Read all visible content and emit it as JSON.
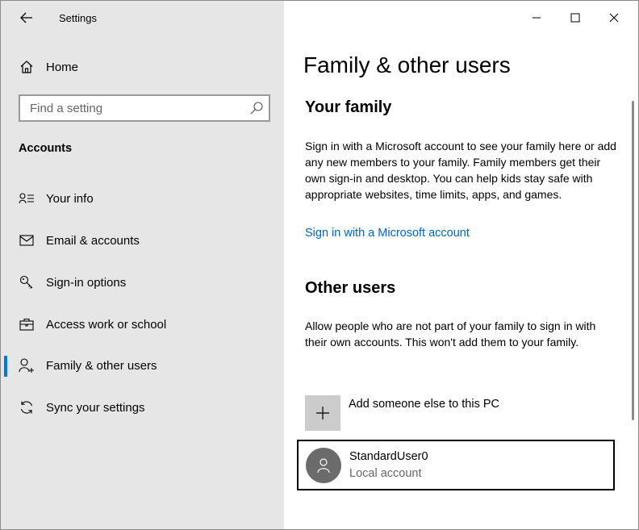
{
  "app": {
    "title": "Settings"
  },
  "sidebar": {
    "home_label": "Home",
    "search": {
      "placeholder": "Find a setting"
    },
    "section_title": "Accounts",
    "items": [
      {
        "label": "Your info",
        "icon": "person-list-icon"
      },
      {
        "label": "Email & accounts",
        "icon": "mail-icon"
      },
      {
        "label": "Sign-in options",
        "icon": "key-icon"
      },
      {
        "label": "Access work or school",
        "icon": "briefcase-icon"
      },
      {
        "label": "Family & other users",
        "icon": "person-add-icon",
        "active": true
      },
      {
        "label": "Sync your settings",
        "icon": "sync-icon"
      }
    ]
  },
  "window_controls": [
    "minimize",
    "maximize",
    "close"
  ],
  "content": {
    "title": "Family & other users",
    "family": {
      "heading": "Your family",
      "description": "Sign in with a Microsoft account to see your family here or add any new members to your family. Family members get their own sign-in and desktop. You can help kids stay safe with appropriate websites, time limits, apps, and games.",
      "link": "Sign in with a Microsoft account"
    },
    "other_users": {
      "heading": "Other users",
      "description": "Allow people who are not part of your family to sign in with their own accounts. This won't add them to your family.",
      "add_label": "Add someone else to this PC",
      "users": [
        {
          "name": "StandardUser0",
          "type": "Local account"
        }
      ]
    }
  },
  "colors": {
    "accent": "#0078d7",
    "link": "#0067c0",
    "sidebar_bg": "#e6e6e6"
  }
}
